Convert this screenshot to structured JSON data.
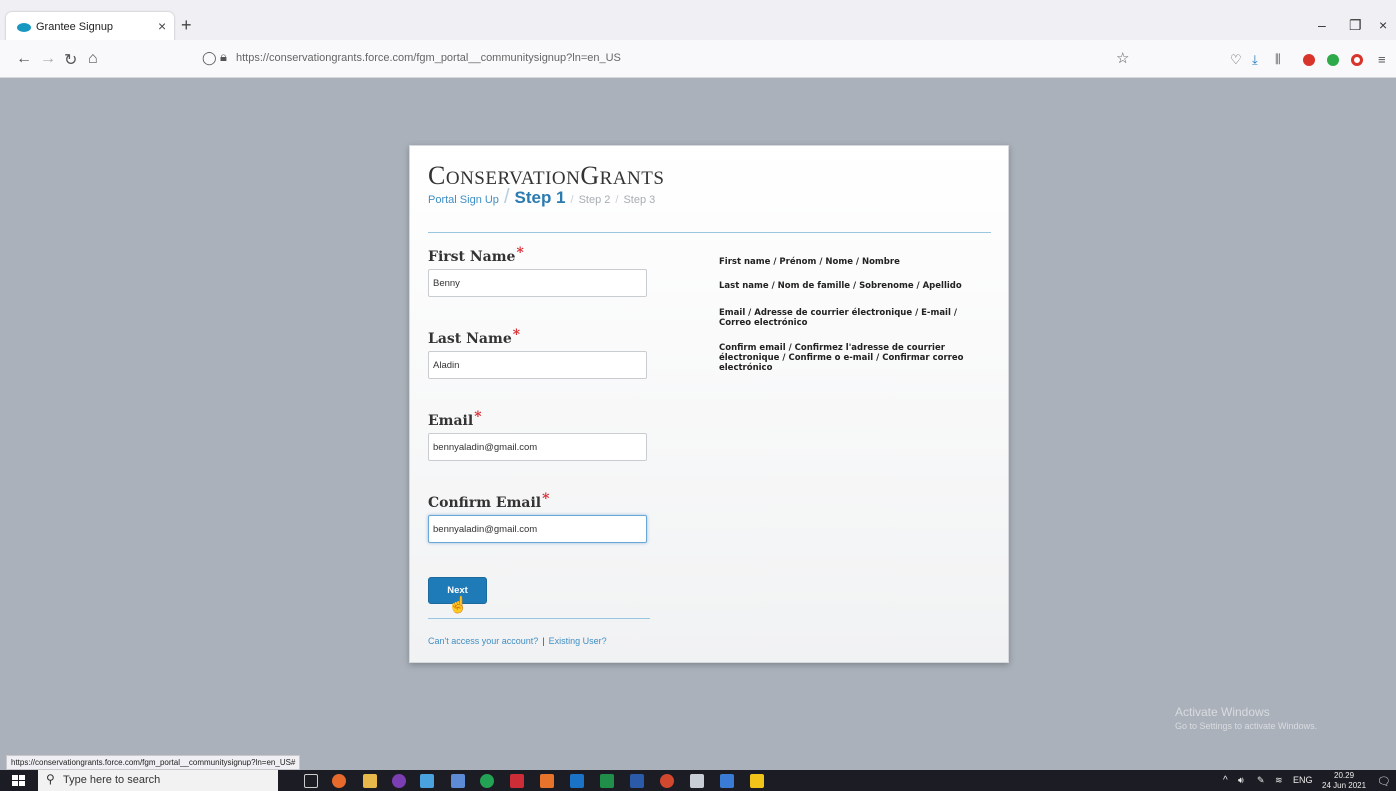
{
  "browser": {
    "tab_title": "Grantee Signup",
    "tab_close": "×",
    "new_tab": "+",
    "url": "https://conservationgrants.force.com/fgm_portal__communitysignup?ln=en_US",
    "minimize": "–",
    "restore": "❐",
    "close": "×",
    "status_url": "https://conservationgrants.force.com/fgm_portal__communitysignup?ln=en_US#"
  },
  "page": {
    "brand_first": "C",
    "brand_first_rest": "ONSERVATION",
    "brand_second": "G",
    "brand_second_rest": "RANTS",
    "breadcrumb": {
      "portal": "Portal Sign Up",
      "sep": "/",
      "step1": "Step 1",
      "step2": "Step 2",
      "step3": "Step 3"
    },
    "required_mark": "*",
    "fields": {
      "first_name": {
        "label": "First Name",
        "value": "Benny"
      },
      "last_name": {
        "label": "Last Name",
        "value": "Aladin"
      },
      "email": {
        "label": "Email",
        "value": "bennyaladin@gmail.com"
      },
      "confirm_email": {
        "label": "Confirm Email",
        "value": "bennyaladin@gmail.com"
      }
    },
    "help": {
      "first_name": "First name / Prénom / Nome / Nombre",
      "last_name": "Last name / Nom de famille / Sobrenome / Apellido",
      "email": "Email / Adresse de courrier électronique / E-mail / Correo electrónico",
      "confirm_email": "Confirm email / Confirmez l'adresse de courrier électronique / Confirme o e-mail / Confirmar correo electrónico"
    },
    "next_label": "Next",
    "links": {
      "cant_access": "Can't access your account?",
      "pipe": "|",
      "existing_user": "Existing User?"
    }
  },
  "watermark": {
    "line1": "Activate Windows",
    "line2": "Go to Settings to activate Windows."
  },
  "taskbar": {
    "search_placeholder": "Type here to search",
    "language": "ENG",
    "time": "20.29",
    "date": "24 Jun 2021"
  },
  "colors": {
    "page_bg": "#aab1ba",
    "accent": "#1f7ab8",
    "required": "#d9282f"
  }
}
